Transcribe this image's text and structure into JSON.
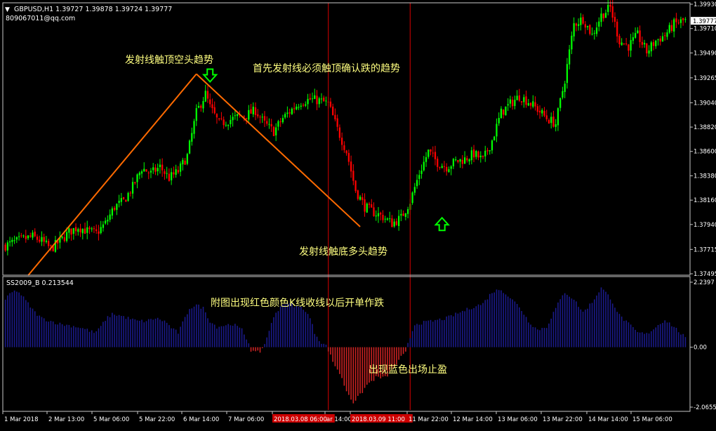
{
  "header": {
    "symbol_line": "GBPUSD,H1  1.39727 1.39878 1.39724 1.39777",
    "account": "809067011@qq.com"
  },
  "indicator": {
    "label": "SS2009_B 0.213544"
  },
  "annotations": {
    "top_short": "发射线触顶空头趋势",
    "confirm": "首先发射线必须触顶确认跌的趋势",
    "bottom_long": "发射线触底多头趋势",
    "sub_red": "附图出现红色颜色K线收线以后开单作跌",
    "sub_blue": "出现蓝色出场止盈"
  },
  "chart_data": [
    {
      "type": "candlestick",
      "symbol": "GBPUSD",
      "timeframe": "H1",
      "ohlc_last": {
        "open": 1.39727,
        "high": 1.39878,
        "low": 1.39724,
        "close": 1.39777
      },
      "current_price_label": "1.39777",
      "y_ticks": [
        "1.39930",
        "1.39710",
        "1.39490",
        "1.39265",
        "1.39040",
        "1.38820",
        "1.38600",
        "1.38380",
        "1.38160",
        "1.37940",
        "1.37715",
        "1.37495"
      ],
      "ylim": [
        1.37495,
        1.3993
      ],
      "x_ticks": [
        "1 Mar 2018",
        "2 Mar 13:00",
        "5 Mar 06:00",
        "5 Mar 22:00",
        "6 Mar 14:00",
        "7 Mar 06:00",
        "2018.03.08 06:00",
        "ar 14:00",
        "2018.03.09 11:00",
        "11 Mar 22:00",
        "12 Mar 14:00",
        "13 Mar 06:00",
        "13 Mar 22:00",
        "14 Mar 14:00",
        "15 Mar 06:00"
      ],
      "x_ticks_highlighted": [
        "2018.03.08 06:00",
        "2018.03.09 11:00"
      ],
      "close_path": [
        [
          0,
          1.3775
        ],
        [
          4,
          1.3778
        ],
        [
          8,
          1.3781
        ],
        [
          12,
          1.3783
        ],
        [
          16,
          1.3779
        ],
        [
          20,
          1.3772
        ],
        [
          24,
          1.3779
        ],
        [
          28,
          1.3787
        ],
        [
          32,
          1.3792
        ],
        [
          36,
          1.3788
        ],
        [
          40,
          1.3786
        ],
        [
          44,
          1.3795
        ],
        [
          48,
          1.381
        ],
        [
          52,
          1.3815
        ],
        [
          56,
          1.3828
        ],
        [
          60,
          1.3845
        ],
        [
          64,
          1.384
        ],
        [
          68,
          1.3846
        ],
        [
          72,
          1.3836
        ],
        [
          76,
          1.3842
        ],
        [
          80,
          1.3856
        ],
        [
          84,
          1.3895
        ],
        [
          88,
          1.3912
        ],
        [
          90,
          1.39
        ],
        [
          94,
          1.3885
        ],
        [
          98,
          1.3888
        ],
        [
          102,
          1.3891
        ],
        [
          106,
          1.3893
        ],
        [
          110,
          1.3897
        ],
        [
          114,
          1.3885
        ],
        [
          118,
          1.3878
        ],
        [
          122,
          1.389
        ],
        [
          126,
          1.3898
        ],
        [
          130,
          1.3905
        ],
        [
          134,
          1.3907
        ],
        [
          138,
          1.3906
        ],
        [
          142,
          1.3903
        ],
        [
          146,
          1.388
        ],
        [
          150,
          1.386
        ],
        [
          154,
          1.3825
        ],
        [
          158,
          1.381
        ],
        [
          162,
          1.3805
        ],
        [
          166,
          1.3801
        ],
        [
          170,
          1.3795
        ],
        [
          174,
          1.38
        ],
        [
          178,
          1.3815
        ],
        [
          182,
          1.384
        ],
        [
          186,
          1.386
        ],
        [
          190,
          1.385
        ],
        [
          194,
          1.3846
        ],
        [
          198,
          1.3851
        ],
        [
          202,
          1.3853
        ],
        [
          206,
          1.3858
        ],
        [
          210,
          1.3852
        ],
        [
          214,
          1.387
        ],
        [
          218,
          1.3895
        ],
        [
          222,
          1.3903
        ],
        [
          226,
          1.391
        ],
        [
          230,
          1.3905
        ],
        [
          234,
          1.3898
        ],
        [
          238,
          1.389
        ],
        [
          242,
          1.3885
        ],
        [
          246,
          1.3925
        ],
        [
          250,
          1.3975
        ],
        [
          254,
          1.398
        ],
        [
          258,
          1.3965
        ],
        [
          262,
          1.3983
        ],
        [
          266,
          1.399
        ],
        [
          270,
          1.396
        ],
        [
          274,
          1.3955
        ],
        [
          278,
          1.3965
        ],
        [
          282,
          1.395
        ],
        [
          286,
          1.396
        ],
        [
          290,
          1.3965
        ],
        [
          294,
          1.3975
        ],
        [
          298,
          1.3978
        ]
      ],
      "total_bars": 300,
      "trend_lines": [
        {
          "from": [
            10,
            1.3748
          ],
          "to": [
            84,
            1.393
          ]
        },
        {
          "from": [
            84,
            1.393
          ],
          "to": [
            156,
            1.3792
          ]
        }
      ],
      "arrows": [
        {
          "bar": 90,
          "price": 1.3928,
          "direction": "down"
        },
        {
          "bar": 192,
          "price": 1.3795,
          "direction": "up"
        }
      ],
      "vertical_lines": [
        142,
        178
      ]
    },
    {
      "type": "histogram",
      "name": "SS2009_B",
      "current_value": 0.213544,
      "y_ticks": [
        "2.2397",
        "0.00",
        "-2.0655"
      ],
      "ylim": [
        -2.0655,
        2.2397
      ],
      "value_path": [
        [
          0,
          1.6
        ],
        [
          2,
          1.85
        ],
        [
          5,
          1.95
        ],
        [
          7,
          1.8
        ],
        [
          10,
          1.5
        ],
        [
          13,
          1.2
        ],
        [
          16,
          1.0
        ],
        [
          20,
          0.9
        ],
        [
          24,
          0.8
        ],
        [
          28,
          0.75
        ],
        [
          32,
          0.7
        ],
        [
          36,
          0.6
        ],
        [
          39,
          0.5
        ],
        [
          41,
          0.6
        ],
        [
          44,
          0.95
        ],
        [
          47,
          1.15
        ],
        [
          50,
          1.1
        ],
        [
          54,
          1.0
        ],
        [
          58,
          0.9
        ],
        [
          62,
          0.9
        ],
        [
          66,
          1.0
        ],
        [
          70,
          0.9
        ],
        [
          74,
          0.6
        ],
        [
          76,
          0.5
        ],
        [
          79,
          1.0
        ],
        [
          81,
          1.35
        ],
        [
          84,
          1.45
        ],
        [
          87,
          1.35
        ],
        [
          90,
          0.9
        ],
        [
          93,
          0.7
        ],
        [
          96,
          0.75
        ],
        [
          100,
          0.8
        ],
        [
          104,
          0.6
        ],
        [
          107,
          0.15
        ],
        [
          108,
          -0.1
        ],
        [
          110,
          -0.2
        ],
        [
          112,
          -0.15
        ],
        [
          114,
          0.1
        ],
        [
          116,
          0.6
        ],
        [
          119,
          1.2
        ],
        [
          122,
          1.5
        ],
        [
          125,
          1.5
        ],
        [
          128,
          1.4
        ],
        [
          131,
          1.35
        ],
        [
          134,
          1.0
        ],
        [
          136,
          0.5
        ],
        [
          139,
          0.15
        ],
        [
          141,
          0.05
        ],
        [
          142,
          -0.1
        ],
        [
          144,
          -0.5
        ],
        [
          147,
          -0.9
        ],
        [
          150,
          -1.5
        ],
        [
          153,
          -1.9
        ],
        [
          156,
          -1.65
        ],
        [
          159,
          -1.3
        ],
        [
          163,
          -1.05
        ],
        [
          167,
          -1.05
        ],
        [
          171,
          -0.7
        ],
        [
          174,
          -0.35
        ],
        [
          176,
          -0.2
        ],
        [
          177,
          0.1
        ],
        [
          180,
          0.8
        ],
        [
          184,
          0.85
        ],
        [
          188,
          0.9
        ],
        [
          194,
          1.0
        ],
        [
          200,
          1.2
        ],
        [
          206,
          1.4
        ],
        [
          210,
          1.5
        ],
        [
          214,
          1.9
        ],
        [
          218,
          2.0
        ],
        [
          222,
          1.7
        ],
        [
          226,
          1.4
        ],
        [
          230,
          0.9
        ],
        [
          234,
          0.6
        ],
        [
          238,
          0.7
        ],
        [
          242,
          1.35
        ],
        [
          246,
          1.9
        ],
        [
          250,
          1.65
        ],
        [
          254,
          1.2
        ],
        [
          258,
          1.55
        ],
        [
          262,
          2.05
        ],
        [
          266,
          1.7
        ],
        [
          270,
          1.1
        ],
        [
          274,
          0.8
        ],
        [
          278,
          0.5
        ],
        [
          282,
          0.45
        ],
        [
          286,
          0.7
        ],
        [
          290,
          0.95
        ],
        [
          294,
          0.7
        ],
        [
          298,
          0.4
        ],
        [
          300,
          0.2
        ]
      ]
    }
  ],
  "colors": {
    "background": "#000000",
    "bull": "#00ff00",
    "bear": "#ff0000",
    "trend": "#ff6a00",
    "arrow": "#00ff00",
    "hist_positive": "#1a1a8a",
    "hist_negative": "#cc2222",
    "vline": "#b40000",
    "text": "#ffffff",
    "annotation": "#ffff80",
    "badge": "#cc0000"
  }
}
